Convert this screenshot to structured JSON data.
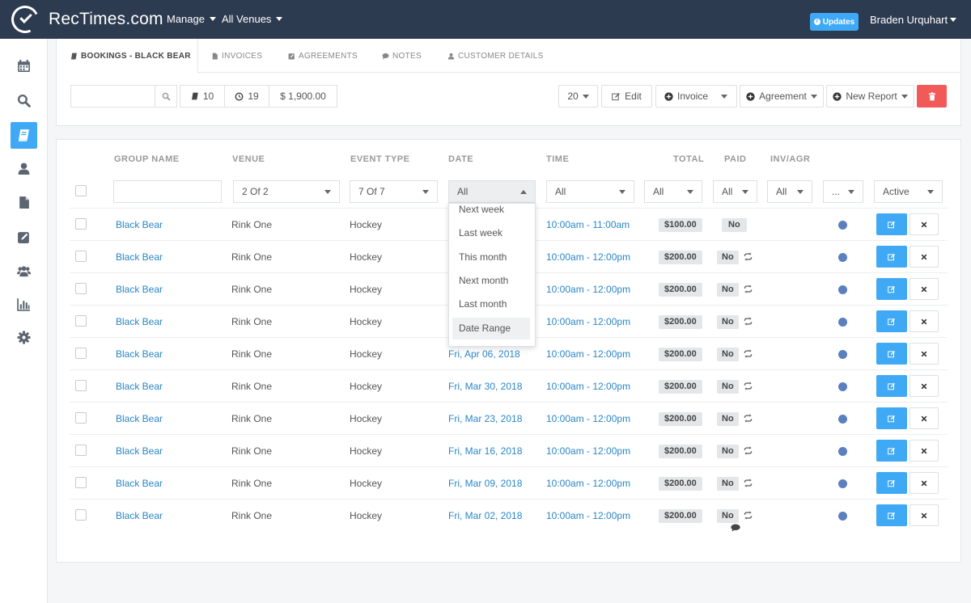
{
  "app": {
    "brand": "RecTimes.com",
    "nav": [
      "Manage",
      "All Venues"
    ],
    "updates_label": "Updates",
    "user_name": "Braden Urquhart"
  },
  "tabs": [
    {
      "label": "BOOKINGS - BLACK BEAR",
      "icon": "book-icon",
      "active": true
    },
    {
      "label": "INVOICES",
      "icon": "file-icon",
      "active": false
    },
    {
      "label": "AGREEMENTS",
      "icon": "pencil-square-icon",
      "active": false
    },
    {
      "label": "NOTES",
      "icon": "comment-icon",
      "active": false
    },
    {
      "label": "CUSTOMER DETAILS",
      "icon": "user-icon",
      "active": false
    }
  ],
  "toolbar": {
    "search_placeholder": "",
    "bookings_count": "10",
    "hours_count": "19",
    "total_amount": "$ 1,900.00",
    "page_size": "20",
    "edit_label": "Edit",
    "invoice_label": "Invoice",
    "agreement_label": "Agreement",
    "new_report_label": "New Report"
  },
  "table": {
    "headers": [
      "GROUP NAME",
      "VENUE",
      "EVENT TYPE",
      "DATE",
      "TIME",
      "TOTAL",
      "PAID",
      "INV/AGR"
    ],
    "filters": {
      "group_name": "",
      "venue": "2 Of 2",
      "event_type": "7 Of 7",
      "date": "All",
      "time": "All",
      "total": "All",
      "paid": "All",
      "inv_agr": "All",
      "extra": "...",
      "status": "Active"
    },
    "rows": [
      {
        "group": "Black Bear",
        "venue": "Rink One",
        "event": "Hockey",
        "date": "",
        "time": "10:00am - 11:00am",
        "total": "$100.00",
        "paid": "No",
        "repeat": false,
        "comment": false
      },
      {
        "group": "Black Bear",
        "venue": "Rink One",
        "event": "Hockey",
        "date": "",
        "time": "10:00am - 12:00pm",
        "total": "$200.00",
        "paid": "No",
        "repeat": true,
        "comment": false
      },
      {
        "group": "Black Bear",
        "venue": "Rink One",
        "event": "Hockey",
        "date": "",
        "time": "10:00am - 12:00pm",
        "total": "$200.00",
        "paid": "No",
        "repeat": true,
        "comment": false
      },
      {
        "group": "Black Bear",
        "venue": "Rink One",
        "event": "Hockey",
        "date": "",
        "time": "10:00am - 12:00pm",
        "total": "$200.00",
        "paid": "No",
        "repeat": true,
        "comment": false
      },
      {
        "group": "Black Bear",
        "venue": "Rink One",
        "event": "Hockey",
        "date": "Fri, Apr 06, 2018",
        "time": "10:00am - 12:00pm",
        "total": "$200.00",
        "paid": "No",
        "repeat": true,
        "comment": false
      },
      {
        "group": "Black Bear",
        "venue": "Rink One",
        "event": "Hockey",
        "date": "Fri, Mar 30, 2018",
        "time": "10:00am - 12:00pm",
        "total": "$200.00",
        "paid": "No",
        "repeat": true,
        "comment": false
      },
      {
        "group": "Black Bear",
        "venue": "Rink One",
        "event": "Hockey",
        "date": "Fri, Mar 23, 2018",
        "time": "10:00am - 12:00pm",
        "total": "$200.00",
        "paid": "No",
        "repeat": true,
        "comment": false
      },
      {
        "group": "Black Bear",
        "venue": "Rink One",
        "event": "Hockey",
        "date": "Fri, Mar 16, 2018",
        "time": "10:00am - 12:00pm",
        "total": "$200.00",
        "paid": "No",
        "repeat": true,
        "comment": false
      },
      {
        "group": "Black Bear",
        "venue": "Rink One",
        "event": "Hockey",
        "date": "Fri, Mar 09, 2018",
        "time": "10:00am - 12:00pm",
        "total": "$200.00",
        "paid": "No",
        "repeat": true,
        "comment": false
      },
      {
        "group": "Black Bear",
        "venue": "Rink One",
        "event": "Hockey",
        "date": "Fri, Mar 02, 2018",
        "time": "10:00am - 12:00pm",
        "total": "$200.00",
        "paid": "No",
        "repeat": true,
        "comment": true
      }
    ]
  },
  "date_dropdown": {
    "options": [
      "Next week",
      "Last week",
      "This month",
      "Next month",
      "Last month",
      "Date Range"
    ],
    "hovered": "Date Range"
  },
  "sidebar": {
    "items": [
      {
        "icon": "calendar-icon",
        "active": false
      },
      {
        "icon": "search-icon",
        "active": false
      },
      {
        "icon": "book-icon",
        "active": true
      },
      {
        "icon": "user-icon",
        "active": false
      },
      {
        "icon": "file-icon",
        "active": false
      },
      {
        "icon": "pencil-square-icon",
        "active": false
      },
      {
        "icon": "users-icon",
        "active": false
      },
      {
        "icon": "bar-chart-icon",
        "active": false
      },
      {
        "icon": "gear-icon",
        "active": false
      }
    ]
  },
  "colors": {
    "topbar": "#2d3b50",
    "accent": "#3fa9f5",
    "link": "#2a86c8",
    "danger": "#f25959",
    "status_dot": "#5b7fbf"
  }
}
